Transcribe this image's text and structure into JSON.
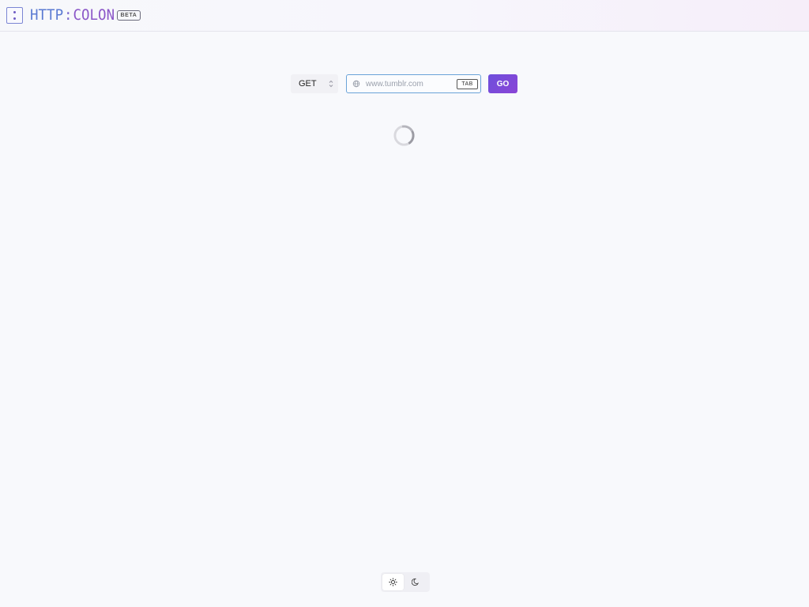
{
  "app": {
    "logo_left": "HTTP",
    "logo_separator": ":",
    "logo_right": "COLON",
    "badge": "BETA"
  },
  "request": {
    "method": "GET",
    "url_value": "",
    "url_placeholder": "www.tumblr.com",
    "tab_hint": "TAB",
    "go_label": "GO"
  },
  "status": {
    "loading": true
  },
  "theme": {
    "options": [
      "light",
      "dark"
    ],
    "selected": "light"
  },
  "colors": {
    "accent": "#7b4fda",
    "input_border": "#6aa3d8",
    "logo_blue": "#5a7ad2",
    "logo_purple": "#8b57c8"
  },
  "icons": {
    "logo": "colon-logo-icon",
    "method_select": "chevron-updown-icon",
    "url": "globe-icon",
    "loading": "spinner-icon",
    "light": "sun-icon",
    "dark": "moon-icon"
  }
}
